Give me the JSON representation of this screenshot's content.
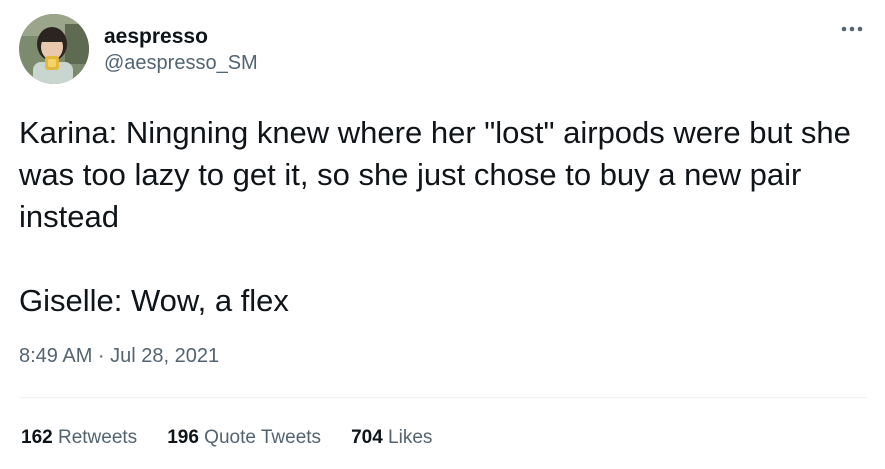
{
  "author": {
    "display_name": "aespresso",
    "handle": "@aespresso_SM",
    "avatar_icon": "profile-photo"
  },
  "more_icon": "more-horizontal-icon",
  "tweet": {
    "text": "Karina: Ningning knew where her \"lost\" airpods were but she was too lazy to get it, so she just chose to buy a new pair instead\n\nGiselle: Wow, a flex",
    "timestamp": "8:49 AM · Jul 28, 2021"
  },
  "stats": {
    "retweets": {
      "count": "162",
      "label": "Retweets"
    },
    "quote_tweets": {
      "count": "196",
      "label": "Quote Tweets"
    },
    "likes": {
      "count": "704",
      "label": "Likes"
    }
  },
  "colors": {
    "text_primary": "#0f1419",
    "text_secondary": "#536471",
    "divider": "#eff3f4"
  }
}
